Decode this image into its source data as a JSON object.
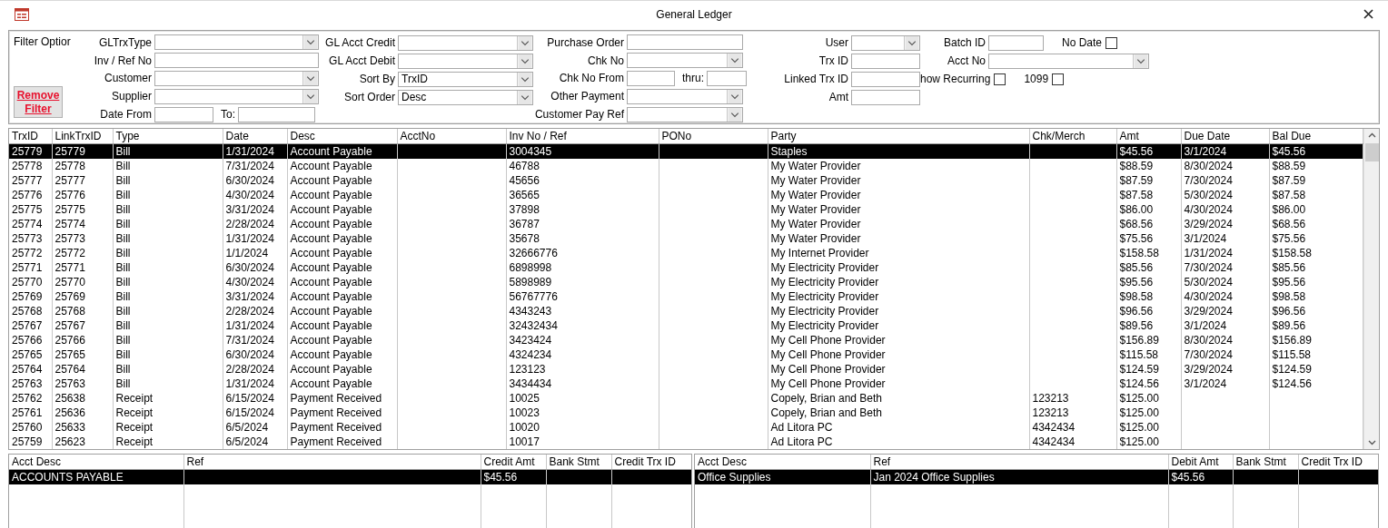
{
  "window": {
    "title": "General Ledger"
  },
  "filter": {
    "heading": "Filter Optior",
    "remove_button": "Remove Filter",
    "columns": [
      [
        [
          {
            "kind": "combo",
            "label": "GLTrxType"
          }
        ],
        [
          {
            "kind": "text",
            "label": "Inv / Ref No"
          }
        ],
        [
          {
            "kind": "combo",
            "label": "Customer"
          }
        ],
        [
          {
            "kind": "combo",
            "label": "Supplier"
          }
        ],
        [
          {
            "kind": "text",
            "label": "Date From"
          },
          {
            "kind": "text",
            "label": "To:"
          }
        ]
      ],
      [
        [
          {
            "kind": "combo",
            "label": "GL Acct Credit"
          }
        ],
        [
          {
            "kind": "combo",
            "label": "GL Acct Debit"
          }
        ],
        [
          {
            "kind": "combo",
            "label": "Sort By",
            "value": "TrxID"
          }
        ],
        [
          {
            "kind": "combo",
            "label": "Sort Order",
            "value": "Desc"
          }
        ]
      ],
      [
        [
          {
            "kind": "text",
            "label": "Purchase Order"
          }
        ],
        [
          {
            "kind": "combo",
            "label": "Chk No"
          }
        ],
        [
          {
            "kind": "text",
            "label": "Chk No From"
          },
          {
            "kind": "text",
            "label": "thru:"
          }
        ],
        [
          {
            "kind": "combo",
            "label": "Other Payment"
          }
        ],
        [
          {
            "kind": "combo",
            "label": "Customer Pay Ref"
          }
        ]
      ],
      [
        [
          {
            "kind": "combo",
            "label": "User"
          }
        ],
        [
          {
            "kind": "text",
            "label": "Trx ID"
          }
        ],
        [
          {
            "kind": "text",
            "label": "Linked Trx ID"
          }
        ],
        [
          {
            "kind": "text",
            "label": "Amt"
          }
        ]
      ],
      [
        [
          {
            "kind": "text",
            "label": "Batch ID"
          },
          {
            "kind": "check",
            "label": "No Date",
            "checked": false
          }
        ],
        [
          {
            "kind": "combo",
            "label": "Acct No"
          }
        ],
        [
          {
            "kind": "check",
            "label": "how Recurring",
            "checked": false
          },
          {
            "kind": "check",
            "label": "1099",
            "checked": false
          }
        ]
      ]
    ]
  },
  "grid": {
    "columns": [
      "TrxID",
      "LinkTrxID",
      "Type",
      "Date",
      "Desc",
      "AcctNo",
      "Inv No / Ref",
      "PONo",
      "Party",
      "Chk/Merch",
      "Amt",
      "Due Date",
      "Bal Due"
    ],
    "rows": [
      {
        "selected": true,
        "cells": [
          "25779",
          "25779",
          "Bill",
          "1/31/2024",
          "Account Payable",
          null,
          "3004345",
          null,
          "Staples",
          null,
          "$45.56",
          "3/1/2024",
          "$45.56"
        ]
      },
      {
        "selected": false,
        "cells": [
          "25778",
          "25778",
          "Bill",
          "7/31/2024",
          "Account Payable",
          null,
          "46788",
          null,
          "My Water Provider",
          null,
          "$88.59",
          "8/30/2024",
          "$88.59"
        ]
      },
      {
        "selected": false,
        "cells": [
          "25777",
          "25777",
          "Bill",
          "6/30/2024",
          "Account Payable",
          null,
          "45656",
          null,
          "My Water Provider",
          null,
          "$87.59",
          "7/30/2024",
          "$87.59"
        ]
      },
      {
        "selected": false,
        "cells": [
          "25776",
          "25776",
          "Bill",
          "4/30/2024",
          "Account Payable",
          null,
          "36565",
          null,
          "My Water Provider",
          null,
          "$87.58",
          "5/30/2024",
          "$87.58"
        ]
      },
      {
        "selected": false,
        "cells": [
          "25775",
          "25775",
          "Bill",
          "3/31/2024",
          "Account Payable",
          null,
          "37898",
          null,
          "My Water Provider",
          null,
          "$86.00",
          "4/30/2024",
          "$86.00"
        ]
      },
      {
        "selected": false,
        "cells": [
          "25774",
          "25774",
          "Bill",
          "2/28/2024",
          "Account Payable",
          null,
          "36787",
          null,
          "My Water Provider",
          null,
          "$68.56",
          "3/29/2024",
          "$68.56"
        ]
      },
      {
        "selected": false,
        "cells": [
          "25773",
          "25773",
          "Bill",
          "1/31/2024",
          "Account Payable",
          null,
          "35678",
          null,
          "My Water Provider",
          null,
          "$75.56",
          "3/1/2024",
          "$75.56"
        ]
      },
      {
        "selected": false,
        "cells": [
          "25772",
          "25772",
          "Bill",
          "1/1/2024",
          "Account Payable",
          null,
          "32666776",
          null,
          "My Internet Provider",
          null,
          "$158.58",
          "1/31/2024",
          "$158.58"
        ]
      },
      {
        "selected": false,
        "cells": [
          "25771",
          "25771",
          "Bill",
          "6/30/2024",
          "Account Payable",
          null,
          "6898998",
          null,
          "My Electricity Provider",
          null,
          "$85.56",
          "7/30/2024",
          "$85.56"
        ]
      },
      {
        "selected": false,
        "cells": [
          "25770",
          "25770",
          "Bill",
          "4/30/2024",
          "Account Payable",
          null,
          "5898989",
          null,
          "My Electricity Provider",
          null,
          "$95.56",
          "5/30/2024",
          "$95.56"
        ]
      },
      {
        "selected": false,
        "cells": [
          "25769",
          "25769",
          "Bill",
          "3/31/2024",
          "Account Payable",
          null,
          "56767776",
          null,
          "My Electricity Provider",
          null,
          "$98.58",
          "4/30/2024",
          "$98.58"
        ]
      },
      {
        "selected": false,
        "cells": [
          "25768",
          "25768",
          "Bill",
          "2/28/2024",
          "Account Payable",
          null,
          "4343243",
          null,
          "My Electricity Provider",
          null,
          "$96.56",
          "3/29/2024",
          "$96.56"
        ]
      },
      {
        "selected": false,
        "cells": [
          "25767",
          "25767",
          "Bill",
          "1/31/2024",
          "Account Payable",
          null,
          "32432434",
          null,
          "My Electricity Provider",
          null,
          "$89.56",
          "3/1/2024",
          "$89.56"
        ]
      },
      {
        "selected": false,
        "cells": [
          "25766",
          "25766",
          "Bill",
          "7/31/2024",
          "Account Payable",
          null,
          "3423424",
          null,
          "My Cell Phone Provider",
          null,
          "$156.89",
          "8/30/2024",
          "$156.89"
        ]
      },
      {
        "selected": false,
        "cells": [
          "25765",
          "25765",
          "Bill",
          "6/30/2024",
          "Account Payable",
          null,
          "4324234",
          null,
          "My Cell Phone Provider",
          null,
          "$115.58",
          "7/30/2024",
          "$115.58"
        ]
      },
      {
        "selected": false,
        "cells": [
          "25764",
          "25764",
          "Bill",
          "2/28/2024",
          "Account Payable",
          null,
          "123123",
          null,
          "My Cell Phone Provider",
          null,
          "$124.59",
          "3/29/2024",
          "$124.59"
        ]
      },
      {
        "selected": false,
        "cells": [
          "25763",
          "25763",
          "Bill",
          "1/31/2024",
          "Account Payable",
          null,
          "3434434",
          null,
          "My Cell Phone Provider",
          null,
          "$124.56",
          "3/1/2024",
          "$124.56"
        ]
      },
      {
        "selected": false,
        "cells": [
          "25762",
          "25638",
          "Receipt",
          "6/15/2024",
          "Payment Received",
          null,
          "10025",
          null,
          "Copely, Brian and Beth",
          "123213",
          "$125.00",
          null,
          null
        ]
      },
      {
        "selected": false,
        "cells": [
          "25761",
          "25636",
          "Receipt",
          "6/15/2024",
          "Payment Received",
          null,
          "10023",
          null,
          "Copely, Brian and Beth",
          "123213",
          "$125.00",
          null,
          null
        ]
      },
      {
        "selected": false,
        "cells": [
          "25760",
          "25633",
          "Receipt",
          "6/5/2024",
          "Payment Received",
          null,
          "10020",
          null,
          "Ad Litora PC",
          "4342434",
          "$125.00",
          null,
          null
        ]
      },
      {
        "selected": false,
        "cells": [
          "25759",
          "25623",
          "Receipt",
          "6/5/2024",
          "Payment Received",
          null,
          "10017",
          null,
          "Ad Litora PC",
          "4342434",
          "$125.00",
          null,
          null
        ]
      }
    ]
  },
  "subforms": [
    {
      "columns": [
        "Acct Desc",
        "Ref",
        "Credit Amt",
        "Bank Stmt",
        "Credit Trx ID"
      ],
      "rows": [
        {
          "selected": true,
          "cells": [
            "ACCOUNTS PAYABLE",
            null,
            "$45.56",
            null,
            null
          ]
        }
      ]
    },
    {
      "columns": [
        "Acct Desc",
        "Ref",
        "Debit Amt",
        "Bank Stmt",
        "Credit Trx ID"
      ],
      "rows": [
        {
          "selected": true,
          "cells": [
            "Office Supplies",
            "Jan 2024 Office Supplies",
            "$45.56",
            null,
            null
          ]
        }
      ]
    }
  ]
}
